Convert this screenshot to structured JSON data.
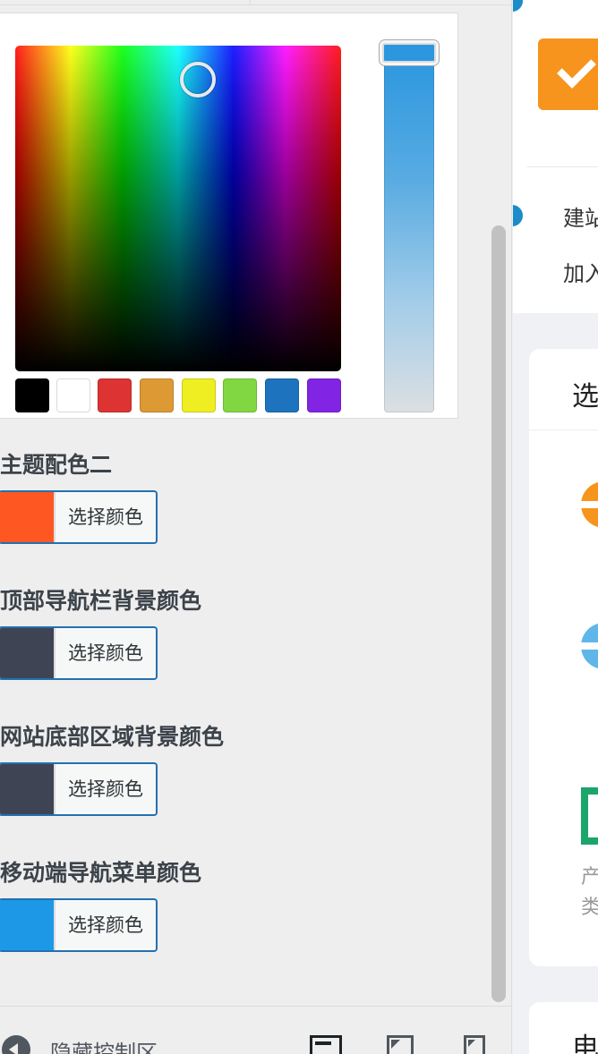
{
  "picker": {
    "palette": [
      "#000000",
      "#ffffff",
      "#dd3333",
      "#dd9933",
      "#eeee22",
      "#81d742",
      "#1e73be",
      "#8224e3"
    ],
    "selected_hue": "#2c97df"
  },
  "settings": [
    {
      "title": "主题配色二",
      "swatch": "#fe5722",
      "button_label": "选择颜色"
    },
    {
      "title": "顶部导航栏背景颜色",
      "swatch": "#3e4454",
      "button_label": "选择颜色"
    },
    {
      "title": "网站底部区域背景颜色",
      "swatch": "#3e4454",
      "button_label": "选择颜色"
    },
    {
      "title": "移动端导航菜单颜色",
      "swatch": "#1d98e7",
      "button_label": "选择颜色"
    }
  ],
  "footer": {
    "collapse_label": "隐藏控制区",
    "devices": [
      "desktop-icon",
      "tablet-icon",
      "mobile-icon"
    ]
  },
  "preview": {
    "line1": "建站",
    "line2": "加入",
    "card_title": "选",
    "text1": "产",
    "text2": "类",
    "card2_title": "电"
  }
}
